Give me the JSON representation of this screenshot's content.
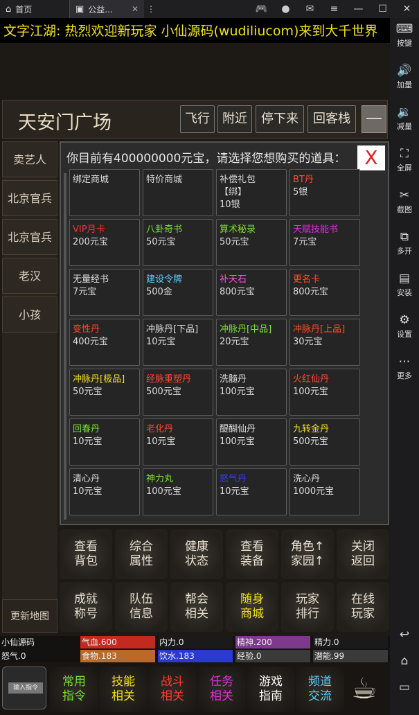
{
  "browser": {
    "home_tab": "首页",
    "game_tab": "公益...",
    "home_icon": "home-icon",
    "game_icon": "app-icon"
  },
  "ticker": {
    "label": "文字江湖:",
    "message": "热烈欢迎新玩家  小仙源码(wudiliucom)来到大千世界"
  },
  "location": {
    "name": "天安门广场",
    "buttons": [
      "飞行",
      "附近",
      "停下来",
      "回客栈"
    ],
    "menu_icon": "—"
  },
  "npcs": [
    "卖艺人",
    "北京官兵",
    "北京官兵",
    "老汉",
    "小孩"
  ],
  "update_map": "更新地图",
  "shop": {
    "title": "你目前有400000000元宝，请选择您想购买的道具：",
    "close": "X",
    "items": [
      {
        "name": "绑定商城",
        "price": "",
        "color": "#dddddd"
      },
      {
        "name": "特价商城",
        "price": "",
        "color": "#dddddd"
      },
      {
        "name": "补偿礼包\n【绑】",
        "price": "10银",
        "color": "#dddddd"
      },
      {
        "name": "BT丹",
        "price": "5银",
        "color": "#ff4b2b"
      },
      {
        "name": "VIP月卡",
        "price": "200元宝",
        "color": "#ff2e2e"
      },
      {
        "name": "八卦奇书",
        "price": "50元宝",
        "color": "#7de034"
      },
      {
        "name": "算术秘录",
        "price": "50元宝",
        "color": "#7de034"
      },
      {
        "name": "天赋技能书",
        "price": "7元宝",
        "color": "#e52de0"
      },
      {
        "name": "无量经书",
        "price": "7元宝",
        "color": "#dddddd"
      },
      {
        "name": "建设令牌",
        "price": "500金",
        "color": "#5fd0ff"
      },
      {
        "name": "补天石",
        "price": "800元宝",
        "color": "#ff52d6"
      },
      {
        "name": "更名卡",
        "price": "800元宝",
        "color": "#ff4b2b"
      },
      {
        "name": "变性丹",
        "price": "400元宝",
        "color": "#ff4b2b"
      },
      {
        "name": "冲脉丹[下品]",
        "price": "10元宝",
        "color": "#dddddd"
      },
      {
        "name": "冲脉丹[中品]",
        "price": "20元宝",
        "color": "#7de034"
      },
      {
        "name": "冲脉丹[上品]",
        "price": "30元宝",
        "color": "#ff4b2b"
      },
      {
        "name": "冲脉丹[极品]",
        "price": "50元宝",
        "color": "#f2e11a"
      },
      {
        "name": "经脉重塑丹",
        "price": "500元宝",
        "color": "#ff4b2b"
      },
      {
        "name": "洗髓丹",
        "price": "100元宝",
        "color": "#dddddd"
      },
      {
        "name": "火红仙丹",
        "price": "100元宝",
        "color": "#ff4b2b"
      },
      {
        "name": "回春丹",
        "price": "10元宝",
        "color": "#7de034"
      },
      {
        "name": "老化丹",
        "price": "10元宝",
        "color": "#ff4b2b"
      },
      {
        "name": "醍醐仙丹",
        "price": "100元宝",
        "color": "#dddddd"
      },
      {
        "name": "九转金丹",
        "price": "500元宝",
        "color": "#f2e11a"
      },
      {
        "name": "清心丹",
        "price": "10元宝",
        "color": "#dddddd"
      },
      {
        "name": "神力丸",
        "price": "100元宝",
        "color": "#7de034"
      },
      {
        "name": "怒气丹",
        "price": "10元宝",
        "color": "#3a3aff"
      },
      {
        "name": "洗心丹",
        "price": "1000元宝",
        "color": "#dddddd"
      }
    ]
  },
  "actions": [
    {
      "label": "查看\n背包",
      "color": "#e8e0d0"
    },
    {
      "label": "综合\n属性",
      "color": "#e8e0d0"
    },
    {
      "label": "健康\n状态",
      "color": "#e8e0d0"
    },
    {
      "label": "查看\n装备",
      "color": "#e8e0d0"
    },
    {
      "label": "角色↑\n家园↑",
      "color": "#e8e0d0"
    },
    {
      "label": "关闭\n返回",
      "color": "#e8e0d0"
    },
    {
      "label": "成就\n称号",
      "color": "#e8e0d0"
    },
    {
      "label": "队伍\n信息",
      "color": "#e8e0d0"
    },
    {
      "label": "帮会\n相关",
      "color": "#e8e0d0"
    },
    {
      "label": "随身\n商城",
      "color": "#f2e11a"
    },
    {
      "label": "玩家\n排行",
      "color": "#e8e0d0"
    },
    {
      "label": "在线\n玩家",
      "color": "#e8e0d0"
    }
  ],
  "stats": {
    "player": "小仙源码",
    "anger": "怒气.0",
    "hp": "气血.600",
    "mp": "内力.0",
    "spirit": "精神.200",
    "energy": "精力.0",
    "food": "食物.183",
    "water": "饮水.183",
    "exp": "经验.0",
    "potential": "潜能.99"
  },
  "bottom_nav": {
    "input_label": "输入指令",
    "items": [
      {
        "label": "常用\n指令",
        "color": "#7de034"
      },
      {
        "label": "技能\n相关",
        "color": "#f2e11a"
      },
      {
        "label": "战斗\n相关",
        "color": "#ff3b2b"
      },
      {
        "label": "任务\n相关",
        "color": "#e52de0"
      },
      {
        "label": "游戏\n指南",
        "color": "#ffffff"
      },
      {
        "label": "频道\n交流",
        "color": "#5fd0ff"
      }
    ],
    "tea_icon": "teacup-icon"
  },
  "emulator": [
    {
      "label": "按键",
      "icon": "keyboard-icon"
    },
    {
      "label": "加量",
      "icon": "volume-up-icon"
    },
    {
      "label": "减量",
      "icon": "volume-down-icon"
    },
    {
      "label": "全屏",
      "icon": "fullscreen-icon"
    },
    {
      "label": "截图",
      "icon": "scissors-icon"
    },
    {
      "label": "多开",
      "icon": "multi-instance-icon"
    },
    {
      "label": "安装",
      "icon": "apk-icon"
    },
    {
      "label": "设置",
      "icon": "gear-icon"
    },
    {
      "label": "更多",
      "icon": "more-icon"
    }
  ]
}
